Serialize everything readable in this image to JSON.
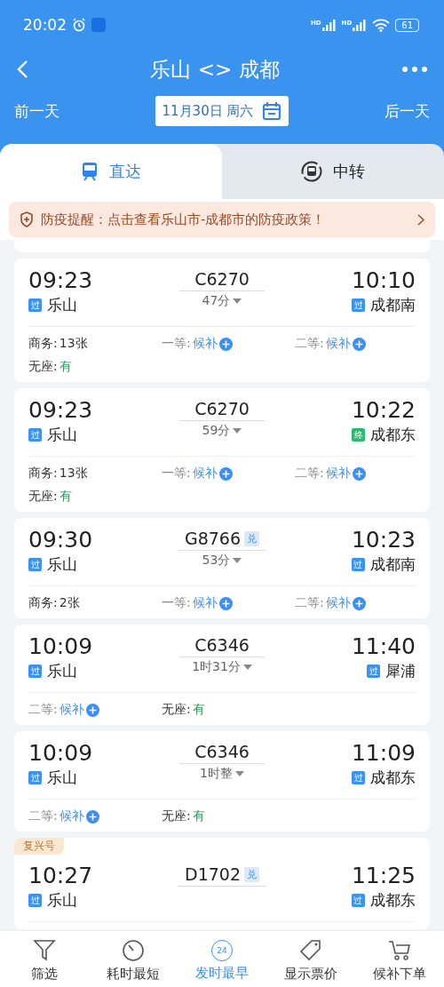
{
  "status_bar": {
    "time": "20:02",
    "signals": [
      "HD",
      "HD"
    ],
    "battery": "61"
  },
  "header": {
    "title": "乐山 <> 成都",
    "prev": "前一天",
    "date": "11月30日 周六",
    "next": "后一天"
  },
  "tabs": [
    {
      "label": "直达",
      "selected": true,
      "kind": "train"
    },
    {
      "label": "中转",
      "selected": false,
      "kind": "transfer"
    }
  ],
  "notice": "防疫提醒：点击查看乐山市-成都市的防疫政策！",
  "trains": [
    {
      "depart": "09:23",
      "from": {
        "tag": "过",
        "kind": "pass",
        "name": "乐山"
      },
      "train_no": "C6270",
      "exchange": false,
      "duration": "47分",
      "arrive": "10:10",
      "to": {
        "tag": "过",
        "kind": "pass",
        "name": "成都南"
      },
      "seats": [
        {
          "label": "商务:",
          "value": "13张",
          "kind": "count"
        },
        {
          "label": "一等:",
          "value": "候补",
          "kind": "waitlist"
        },
        {
          "label": "二等:",
          "value": "候补",
          "kind": "waitlist"
        },
        {
          "label": "无座:",
          "value": "有",
          "kind": "available"
        }
      ]
    },
    {
      "depart": "09:23",
      "from": {
        "tag": "过",
        "kind": "pass",
        "name": "乐山"
      },
      "train_no": "C6270",
      "exchange": false,
      "duration": "59分",
      "arrive": "10:22",
      "to": {
        "tag": "终",
        "kind": "terminal",
        "name": "成都东"
      },
      "seats": [
        {
          "label": "商务:",
          "value": "13张",
          "kind": "count"
        },
        {
          "label": "一等:",
          "value": "候补",
          "kind": "waitlist"
        },
        {
          "label": "二等:",
          "value": "候补",
          "kind": "waitlist"
        },
        {
          "label": "无座:",
          "value": "有",
          "kind": "available"
        }
      ]
    },
    {
      "depart": "09:30",
      "from": {
        "tag": "过",
        "kind": "pass",
        "name": "乐山"
      },
      "train_no": "G8766",
      "exchange": true,
      "exchange_mark": "兑",
      "duration": "53分",
      "arrive": "10:23",
      "to": {
        "tag": "过",
        "kind": "pass",
        "name": "成都南"
      },
      "seats": [
        {
          "label": "商务:",
          "value": "2张",
          "kind": "count"
        },
        {
          "label": "一等:",
          "value": "候补",
          "kind": "waitlist"
        },
        {
          "label": "二等:",
          "value": "候补",
          "kind": "waitlist"
        }
      ]
    },
    {
      "depart": "10:09",
      "from": {
        "tag": "过",
        "kind": "pass",
        "name": "乐山"
      },
      "train_no": "C6346",
      "exchange": false,
      "duration": "1时31分",
      "arrive": "11:40",
      "to": {
        "tag": "过",
        "kind": "pass",
        "name": "犀浦"
      },
      "seats": [
        {
          "label": "二等:",
          "value": "候补",
          "kind": "waitlist"
        },
        {
          "label": "无座:",
          "value": "有",
          "kind": "available"
        }
      ]
    },
    {
      "depart": "10:09",
      "from": {
        "tag": "过",
        "kind": "pass",
        "name": "乐山"
      },
      "train_no": "C6346",
      "exchange": false,
      "duration": "1时整",
      "arrive": "11:09",
      "to": {
        "tag": "过",
        "kind": "pass",
        "name": "成都东"
      },
      "seats": [
        {
          "label": "二等:",
          "value": "候补",
          "kind": "waitlist"
        },
        {
          "label": "无座:",
          "value": "有",
          "kind": "available"
        }
      ]
    },
    {
      "badge": "复兴号",
      "depart": "10:27",
      "from": {
        "tag": "过",
        "kind": "pass",
        "name": "乐山"
      },
      "train_no": "D1702",
      "exchange": true,
      "exchange_mark": "兑",
      "arrive": "11:25",
      "to": {
        "tag": "过",
        "kind": "pass",
        "name": "成都东"
      }
    }
  ],
  "bottom_nav": [
    {
      "label": "筛选",
      "kind": "filter",
      "selected": false
    },
    {
      "label": "耗时最短",
      "kind": "timer",
      "selected": false
    },
    {
      "label": "发时最早",
      "kind": "clock",
      "icon_text": "24",
      "selected": true
    },
    {
      "label": "显示票价",
      "kind": "price",
      "selected": false
    },
    {
      "label": "候补下单",
      "kind": "cart",
      "selected": false
    }
  ]
}
